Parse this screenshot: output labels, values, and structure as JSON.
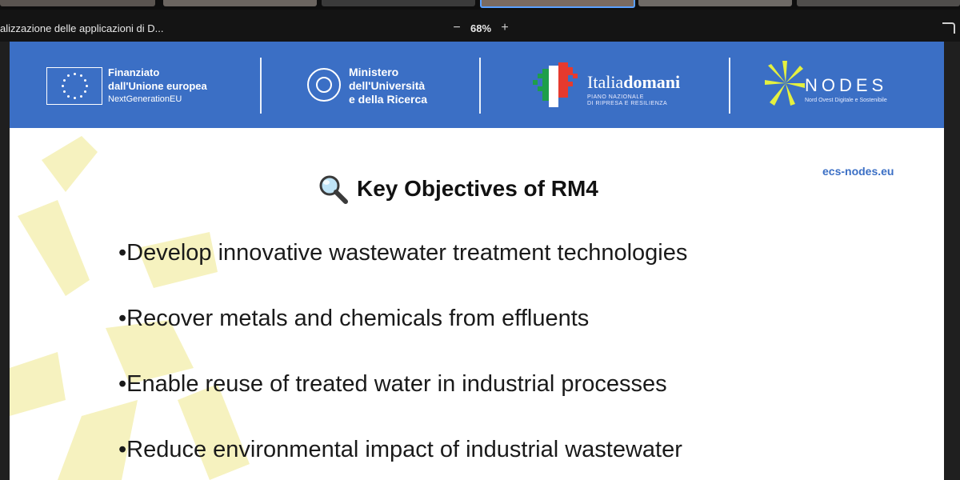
{
  "share_bar": {
    "title": "alizzazione delle applicazioni di D...",
    "zoom_out": "−",
    "zoom_level": "68%",
    "zoom_in": "+"
  },
  "slide": {
    "logos": {
      "eu": {
        "line1": "Finanziato",
        "line2": "dall'Unione europea",
        "line3": "NextGenerationEU"
      },
      "mur": {
        "line1": "Ministero",
        "line2": "dell'Università",
        "line3": "e della Ricerca"
      },
      "italia": {
        "name_regular": "Italia",
        "name_bold": "domani",
        "sub1": "PIANO NAZIONALE",
        "sub2": "DI RIPRESA E RESILIENZA"
      },
      "nodes": {
        "name": "NODES",
        "sub": "Nord Ovest Digitale e Sostenibile"
      }
    },
    "website": "ecs-nodes.eu",
    "title": "Key Objectives of RM4",
    "bullets": [
      "•Develop innovative wastewater treatment technologies",
      "•Recover metals and chemicals from effluents",
      "•Enable reuse of treated water in industrial processes",
      "•Reduce environmental impact of industrial wastewater"
    ]
  },
  "colors": {
    "banner": "#3b6fc5",
    "accent": "#3b6fc5",
    "deco": "#f4f0b0"
  }
}
